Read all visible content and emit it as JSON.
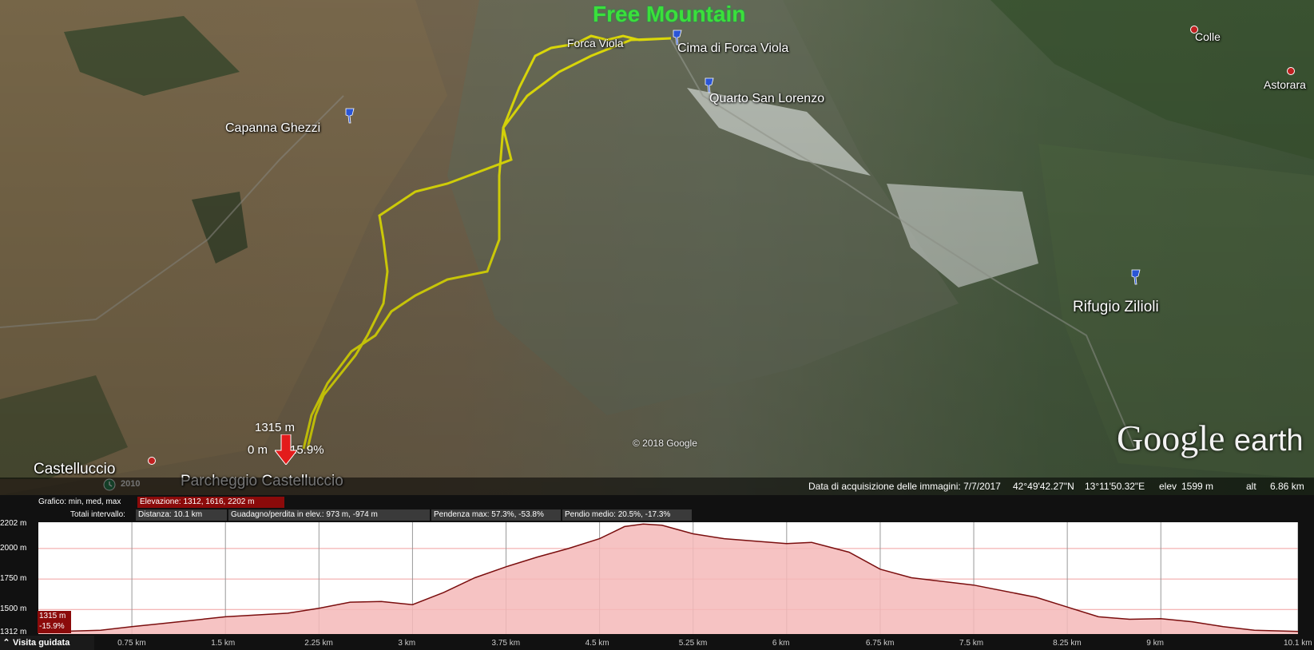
{
  "map": {
    "watermark": "Free Mountain",
    "labels": {
      "forca_viola": "Forca Viola",
      "cima_forca_viola": "Cima di Forca Viola",
      "quarto_san_lorenzo": "Quarto San Lorenzo",
      "capanna_ghezzi": "Capanna Ghezzi",
      "rifugio_zilioli": "Rifugio Zilioli",
      "castelluccio": "Castelluccio",
      "parcheggio": "Parcheggio Castelluccio",
      "colle": "Colle",
      "astorara": "Astorara"
    },
    "marker": {
      "elevation": "1315 m",
      "distance": "0 m",
      "slope": "-15.9%"
    },
    "imagery_year": "2010",
    "copyright": "© 2018 Google",
    "logo_main": "Google",
    "logo_sub": "earth",
    "track_color": "#f5f20a"
  },
  "statusbar": {
    "acquisition": "Data di acquisizione delle immagini: 7/7/2017",
    "lat": "42°49'42.27\"N",
    "lon": "13°11'50.32\"E",
    "elev_label": "elev",
    "elev": "1599 m",
    "alt_label": "alt",
    "alt": "6.86 km"
  },
  "profile": {
    "graph_label": "Grafico: min, med, max",
    "elevation_box": "Elevazione: 1312, 1616, 2202 m",
    "totals_label": "Totali intervallo:",
    "distance_box": "Distanza: 10.1 km",
    "gain_box": "Guadagno/perdita in elev.: 973 m, -974 m",
    "max_slope_box": "Pendenza max: 57.3%, -53.8%",
    "avg_slope_box": "Pendio medio: 20.5%, -17.3%",
    "y_ticks": [
      "2202 m",
      "2000 m",
      "1750 m",
      "1500 m",
      "1312 m"
    ],
    "x_ticks": [
      "0.75 km",
      "1.5 km",
      "2.25 km",
      "3 km",
      "3.75 km",
      "4.5 km",
      "5.25 km",
      "6 km",
      "6.75 km",
      "7.5 km",
      "8.25 km",
      "9 km",
      "10.1 km"
    ],
    "cursor_elev": "1315 m",
    "cursor_slope": "-15.9%",
    "tour_button": "Visita guidata",
    "fill_color": "#f4b8b8",
    "line_color": "#7a0e0e"
  },
  "chart_data": {
    "type": "area",
    "title": "",
    "xlabel": "",
    "ylabel": "",
    "x_unit": "km",
    "y_unit": "m",
    "ylim": [
      1312,
      2202
    ],
    "xlim": [
      0,
      10.1
    ],
    "series": [
      {
        "x": [
          0,
          0.5,
          0.75,
          1.0,
          1.5,
          2.0,
          2.25,
          2.5,
          2.75,
          3.0,
          3.25,
          3.5,
          3.75,
          4.0,
          4.25,
          4.5,
          4.7,
          4.85,
          5.0,
          5.25,
          5.5,
          6.0,
          6.2,
          6.5,
          6.75,
          7.0,
          7.5,
          8.0,
          8.25,
          8.5,
          8.75,
          9.0,
          9.25,
          9.5,
          9.75,
          10.1
        ],
        "y": [
          1315,
          1330,
          1360,
          1385,
          1440,
          1470,
          1510,
          1560,
          1565,
          1540,
          1640,
          1760,
          1850,
          1930,
          2000,
          2080,
          2180,
          2200,
          2190,
          2120,
          2080,
          2040,
          2050,
          1970,
          1830,
          1760,
          1700,
          1600,
          1520,
          1440,
          1420,
          1425,
          1400,
          1360,
          1330,
          1320
        ]
      }
    ]
  }
}
